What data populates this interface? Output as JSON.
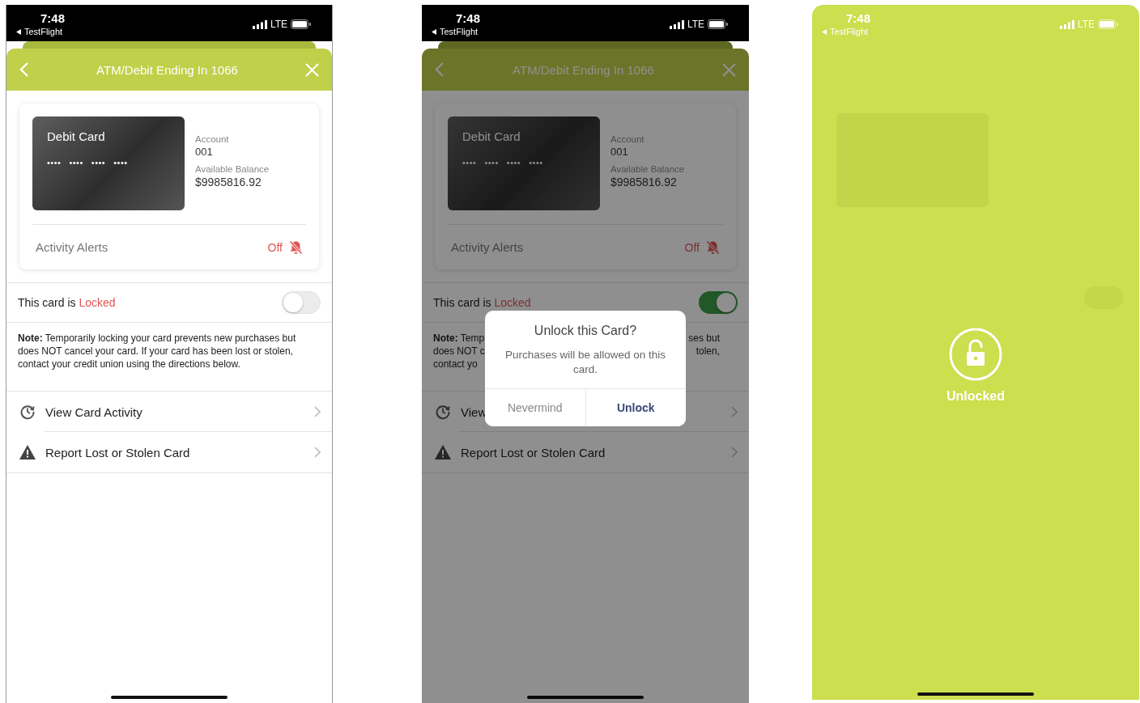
{
  "screens": [
    {
      "kind": "details",
      "status_bar": {
        "time": "7:48",
        "back_app": "TestFlight",
        "network": "LTE"
      },
      "header": {
        "title": "ATM/Debit Ending In 1066"
      },
      "card": {
        "name": "Debit Card",
        "number_mask": [
          "••••",
          "••••",
          "••••",
          "••••"
        ],
        "account_label": "Account",
        "account": "001",
        "balance_label": "Available Balance",
        "balance": "$9985816.92"
      },
      "alerts": {
        "label": "Activity Alerts",
        "state": "Off"
      },
      "lock_row": {
        "label": "This card is",
        "status": "Locked",
        "on": false
      },
      "note": "**Note:** Temporarily locking your card prevents new purchases but does NOT cancel your card. If your card has been lost or stolen, contact your credit union using the directions below.",
      "actions": [
        {
          "kind": "history",
          "label": "View Card Activity"
        },
        {
          "kind": "warning",
          "label": "Report Lost or Stolen Card"
        }
      ]
    },
    {
      "kind": "details",
      "status_bar": {
        "time": "7:48",
        "back_app": "TestFlight",
        "network": "LTE"
      },
      "header": {
        "title": "ATM/Debit Ending In 1066"
      },
      "card": {
        "name": "Debit Card",
        "number_mask": [
          "••••",
          "••••",
          "••••",
          "••••"
        ],
        "account_label": "Account",
        "account": "001",
        "balance_label": "Available Balance",
        "balance": "$9985816.92"
      },
      "alerts": {
        "label": "Activity Alerts",
        "state": "Off"
      },
      "lock_row": {
        "label": "This card is",
        "status": "Locked",
        "on": true
      },
      "note_left": [
        "**Note:** Temp",
        "does NOT c",
        "contact yo"
      ],
      "note_right": [
        "ses but",
        "tolen,"
      ],
      "actions": [
        {
          "kind": "history",
          "label": "View"
        },
        {
          "kind": "warning",
          "label": "Report Lost or Stolen Card"
        }
      ],
      "dialog": {
        "title": "Unlock this Card?",
        "message": "Purchases will be allowed on this card.",
        "buttons": [
          {
            "label": "Nevermind",
            "kind": "cancel"
          },
          {
            "label": "Unlock",
            "kind": "confirm"
          }
        ]
      }
    },
    {
      "kind": "unlocked",
      "status_bar": {
        "time": "7:48",
        "back_app": "TestFlight",
        "network": "LTE"
      },
      "toast": {
        "label": "Unlocked"
      }
    }
  ]
}
